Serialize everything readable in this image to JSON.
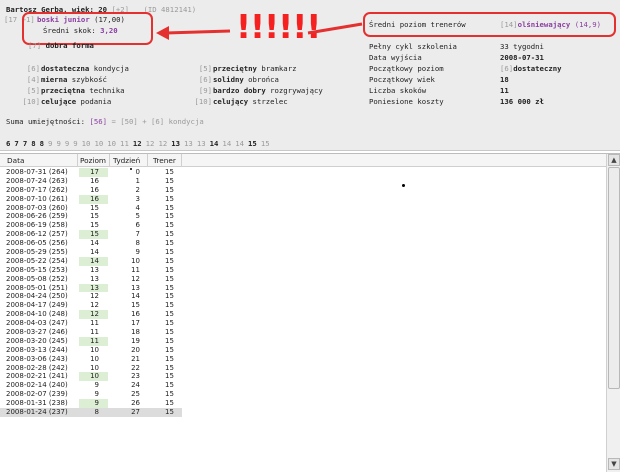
{
  "player": {
    "name": "Bartosz Gerba, wiek: 20",
    "age_bonus": "[+2]",
    "id_text": "(ID 4812141)",
    "level_prefix": "[17 +1]",
    "title": "boski junior",
    "title_value": "(17,00)",
    "avg_jump_label": "Średni skok:",
    "avg_jump_value": "3,20",
    "form_level": "[7]",
    "form_text": "dobra forma"
  },
  "annotation": {
    "exclamation": "!!!!!!"
  },
  "skills_left": [
    {
      "level": "[6]",
      "text": "dostateczna kondycja",
      "bold_prefix": "dostateczna",
      "rest": " kondycja"
    },
    {
      "level": "[4]",
      "text": "mierna szybkość",
      "bold_prefix": "mierna",
      "rest": " szybkość"
    },
    {
      "level": "[5]",
      "text": "przeciętna technika",
      "bold_prefix": "przeciętna",
      "rest": " technika"
    },
    {
      "level": "[10]",
      "text": "celujące podania",
      "bold_prefix": "celujące",
      "rest": " podania"
    }
  ],
  "skills_mid": [
    {
      "level": "[5]",
      "bold_prefix": "przeciętny",
      "rest": " bramkarz"
    },
    {
      "level": "[6]",
      "bold_prefix": "solidny",
      "rest": " obrońca"
    },
    {
      "level": "[9]",
      "bold_prefix": "bardzo dobry",
      "rest": " rozgrywający"
    },
    {
      "level": "[10]",
      "bold_prefix": "celujący",
      "rest": " strzelec"
    }
  ],
  "trainer": {
    "label": "Średni poziom trenerów",
    "value_prefix": "[14]",
    "value_bold": "olśniewający",
    "value_suffix": "(14,9)"
  },
  "info_rows": [
    {
      "label": "Pełny cykl szkolenia",
      "prefix": "",
      "value": "33 tygodni",
      "bold": false
    },
    {
      "label": "Data wyjścia",
      "prefix": "",
      "value": "2008-07-31",
      "bold": true
    },
    {
      "label": "Początkowy poziom",
      "prefix": "[6]",
      "value": "dostateczny",
      "bold": true
    },
    {
      "label": "Początkowy wiek",
      "prefix": "",
      "value": "18",
      "bold": true
    },
    {
      "label": "Liczba skoków",
      "prefix": "",
      "value": "11",
      "bold": true
    },
    {
      "label": "Poniesione koszty",
      "prefix": "",
      "value": "136 000 zł",
      "bold": true
    }
  ],
  "summary": {
    "label": "Suma umiejętności:",
    "total": "[56]",
    "eq": "= [50] + [6] kondycja"
  },
  "scale": [
    {
      "n": "6",
      "b": true
    },
    {
      "n": "7",
      "b": true
    },
    {
      "n": "7",
      "b": true
    },
    {
      "n": "8",
      "b": true
    },
    {
      "n": "8",
      "b": true
    },
    {
      "n": "9",
      "b": false
    },
    {
      "n": "9",
      "b": false
    },
    {
      "n": "9",
      "b": false
    },
    {
      "n": "9",
      "b": false
    },
    {
      "n": "10",
      "b": false
    },
    {
      "n": "10",
      "b": false
    },
    {
      "n": "10",
      "b": false
    },
    {
      "n": "11",
      "b": false
    },
    {
      "n": "12",
      "b": true
    },
    {
      "n": "12",
      "b": false
    },
    {
      "n": "12",
      "b": false
    },
    {
      "n": "13",
      "b": true
    },
    {
      "n": "13",
      "b": false
    },
    {
      "n": "13",
      "b": false
    },
    {
      "n": "14",
      "b": true
    },
    {
      "n": "14",
      "b": false
    },
    {
      "n": "14",
      "b": false
    },
    {
      "n": "15",
      "b": true
    },
    {
      "n": "15",
      "b": false
    }
  ],
  "table": {
    "headers": [
      "Data",
      "Poziom",
      "Tydzień",
      "Trener"
    ],
    "rows": [
      {
        "date": "2008-07-31 (264)",
        "level": "17",
        "week": "0",
        "trainer": "15",
        "hi": true
      },
      {
        "date": "2008-07-24 (263)",
        "level": "16",
        "week": "1",
        "trainer": "15",
        "hi": false
      },
      {
        "date": "2008-07-17 (262)",
        "level": "16",
        "week": "2",
        "trainer": "15",
        "hi": false
      },
      {
        "date": "2008-07-10 (261)",
        "level": "16",
        "week": "3",
        "trainer": "15",
        "hi": true
      },
      {
        "date": "2008-07-03 (260)",
        "level": "15",
        "week": "4",
        "trainer": "15",
        "hi": false
      },
      {
        "date": "2008-06-26 (259)",
        "level": "15",
        "week": "5",
        "trainer": "15",
        "hi": false
      },
      {
        "date": "2008-06-19 (258)",
        "level": "15",
        "week": "6",
        "trainer": "15",
        "hi": false
      },
      {
        "date": "2008-06-12 (257)",
        "level": "15",
        "week": "7",
        "trainer": "15",
        "hi": true
      },
      {
        "date": "2008-06-05 (256)",
        "level": "14",
        "week": "8",
        "trainer": "15",
        "hi": false
      },
      {
        "date": "2008-05-29 (255)",
        "level": "14",
        "week": "9",
        "trainer": "15",
        "hi": false
      },
      {
        "date": "2008-05-22 (254)",
        "level": "14",
        "week": "10",
        "trainer": "15",
        "hi": true
      },
      {
        "date": "2008-05-15 (253)",
        "level": "13",
        "week": "11",
        "trainer": "15",
        "hi": false
      },
      {
        "date": "2008-05-08 (252)",
        "level": "13",
        "week": "12",
        "trainer": "15",
        "hi": false
      },
      {
        "date": "2008-05-01 (251)",
        "level": "13",
        "week": "13",
        "trainer": "15",
        "hi": true
      },
      {
        "date": "2008-04-24 (250)",
        "level": "12",
        "week": "14",
        "trainer": "15",
        "hi": false
      },
      {
        "date": "2008-04-17 (249)",
        "level": "12",
        "week": "15",
        "trainer": "15",
        "hi": false
      },
      {
        "date": "2008-04-10 (248)",
        "level": "12",
        "week": "16",
        "trainer": "15",
        "hi": true
      },
      {
        "date": "2008-04-03 (247)",
        "level": "11",
        "week": "17",
        "trainer": "15",
        "hi": false
      },
      {
        "date": "2008-03-27 (246)",
        "level": "11",
        "week": "18",
        "trainer": "15",
        "hi": false
      },
      {
        "date": "2008-03-20 (245)",
        "level": "11",
        "week": "19",
        "trainer": "15",
        "hi": true
      },
      {
        "date": "2008-03-13 (244)",
        "level": "10",
        "week": "20",
        "trainer": "15",
        "hi": false
      },
      {
        "date": "2008-03-06 (243)",
        "level": "10",
        "week": "21",
        "trainer": "15",
        "hi": false
      },
      {
        "date": "2008-02-28 (242)",
        "level": "10",
        "week": "22",
        "trainer": "15",
        "hi": false
      },
      {
        "date": "2008-02-21 (241)",
        "level": "10",
        "week": "23",
        "trainer": "15",
        "hi": true
      },
      {
        "date": "2008-02-14 (240)",
        "level": "9",
        "week": "24",
        "trainer": "15",
        "hi": false
      },
      {
        "date": "2008-02-07 (239)",
        "level": "9",
        "week": "25",
        "trainer": "15",
        "hi": false
      },
      {
        "date": "2008-01-31 (238)",
        "level": "9",
        "week": "26",
        "trainer": "15",
        "hi": true
      },
      {
        "date": "2008-01-24 (237)",
        "level": "8",
        "week": "27",
        "trainer": "15",
        "hi": false,
        "sel": true
      }
    ]
  },
  "scrollbar": {
    "up": "▲",
    "down": "▼"
  }
}
